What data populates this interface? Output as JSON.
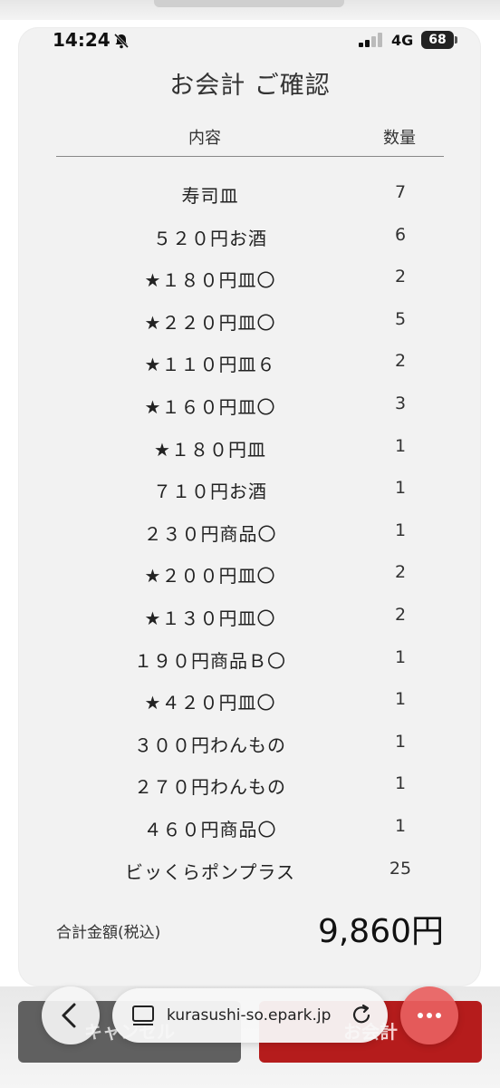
{
  "status": {
    "time": "14:24",
    "network": "4G",
    "battery": "68"
  },
  "page": {
    "title": "お会計 ご確認",
    "col_content": "内容",
    "col_qty": "数量"
  },
  "items": [
    {
      "name": "寿司皿",
      "qty": "7"
    },
    {
      "name": "５２０円お酒",
      "qty": "6"
    },
    {
      "name": "★１８０円皿〇",
      "qty": "2"
    },
    {
      "name": "★２２０円皿〇",
      "qty": "5"
    },
    {
      "name": "★１１０円皿６",
      "qty": "2"
    },
    {
      "name": "★１６０円皿〇",
      "qty": "3"
    },
    {
      "name": "★１８０円皿",
      "qty": "1"
    },
    {
      "name": "７１０円お酒",
      "qty": "1"
    },
    {
      "name": "２３０円商品〇",
      "qty": "1"
    },
    {
      "name": "★２００円皿〇",
      "qty": "2"
    },
    {
      "name": "★１３０円皿〇",
      "qty": "2"
    },
    {
      "name": "１９０円商品Ｂ〇",
      "qty": "1"
    },
    {
      "name": "★４２０円皿〇",
      "qty": "1"
    },
    {
      "name": "３００円わんもの",
      "qty": "1"
    },
    {
      "name": "２７０円わんもの",
      "qty": "1"
    },
    {
      "name": "４６０円商品〇",
      "qty": "1"
    },
    {
      "name": "ビッくらポンプラス",
      "qty": "25"
    }
  ],
  "total": {
    "label": "合計金額(税込)",
    "value": "9,860円"
  },
  "buttons": {
    "left_label": "キャンセル",
    "right_label": "お会計"
  },
  "browser": {
    "url": "kurasushi-so.epark.jp"
  },
  "colors": {
    "accent": "#b51c1c",
    "secondary_button": "#606060",
    "card_bg": "#f2f2f2"
  }
}
